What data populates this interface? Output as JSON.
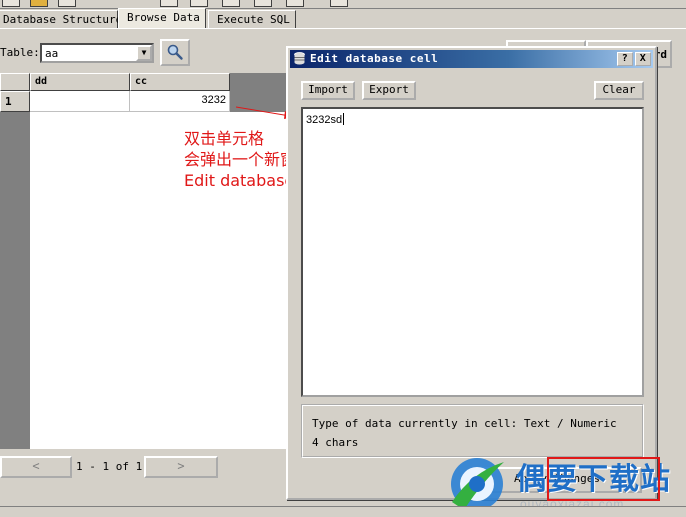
{
  "tabs": [
    {
      "label": "Database Structure"
    },
    {
      "label": "Browse Data"
    },
    {
      "label": "Execute SQL"
    }
  ],
  "browse": {
    "table_label": "Table:",
    "table_value": "aa",
    "columns": [
      "dd",
      "cc"
    ],
    "rows": [
      {
        "row_num": "1",
        "cells": [
          "",
          "3232"
        ]
      }
    ],
    "pager": {
      "prev": "<",
      "next": ">",
      "status": "1 - 1 of 1"
    },
    "right_button_fragment": "rd"
  },
  "annotation": {
    "line1": "双击单元格",
    "line2": "会弹出一个新窗口",
    "line3": "Edit database cell",
    "color": "#e01818"
  },
  "dialog": {
    "title": "Edit database cell",
    "help_btn": "?",
    "close_btn": "X",
    "import_label": "Import",
    "export_label": "Export",
    "clear_label": "Clear",
    "cell_text": "3232sd",
    "type_info": "Type of data currently in cell: Text / Numeric",
    "chars_info": "4 chars",
    "apply_label": "Apply Changes"
  },
  "watermark": {
    "text": "偶要下载站",
    "sub": "ouyaoxiazai.com"
  },
  "colors": {
    "titlebar": "#0a246a",
    "window_bg": "#d4d0c8"
  }
}
